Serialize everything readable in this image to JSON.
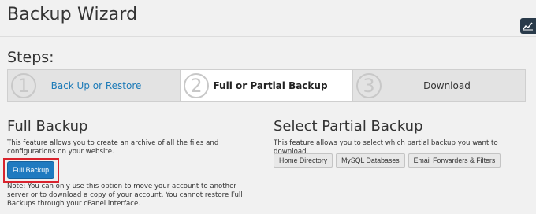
{
  "page": {
    "title": "Backup Wizard",
    "stats_icon": "chart-icon"
  },
  "steps": {
    "heading": "Steps:",
    "items": [
      {
        "number": "1",
        "label": "Back Up or Restore",
        "state": "link"
      },
      {
        "number": "2",
        "label": "Full or Partial Backup",
        "state": "active"
      },
      {
        "number": "3",
        "label": "Download",
        "state": "upcoming"
      }
    ]
  },
  "full_backup": {
    "title": "Full Backup",
    "description": "This feature allows you to create an archive of all the files and configurations on your website.",
    "button_label": "Full Backup",
    "note": "Note: You can only use this option to move your account to another server or to download a copy of your account. You cannot restore Full Backups through your cPanel interface."
  },
  "partial_backup": {
    "title": "Select Partial Backup",
    "description": "This feature allows you to select which partial backup you want to download.",
    "buttons": [
      {
        "label": "Home Directory"
      },
      {
        "label": "MySQL Databases"
      },
      {
        "label": "Email Forwarders & Filters"
      }
    ]
  },
  "colors": {
    "accent": "#1f7ac0",
    "link": "#1d7bb8",
    "highlight": "#d9232d"
  }
}
